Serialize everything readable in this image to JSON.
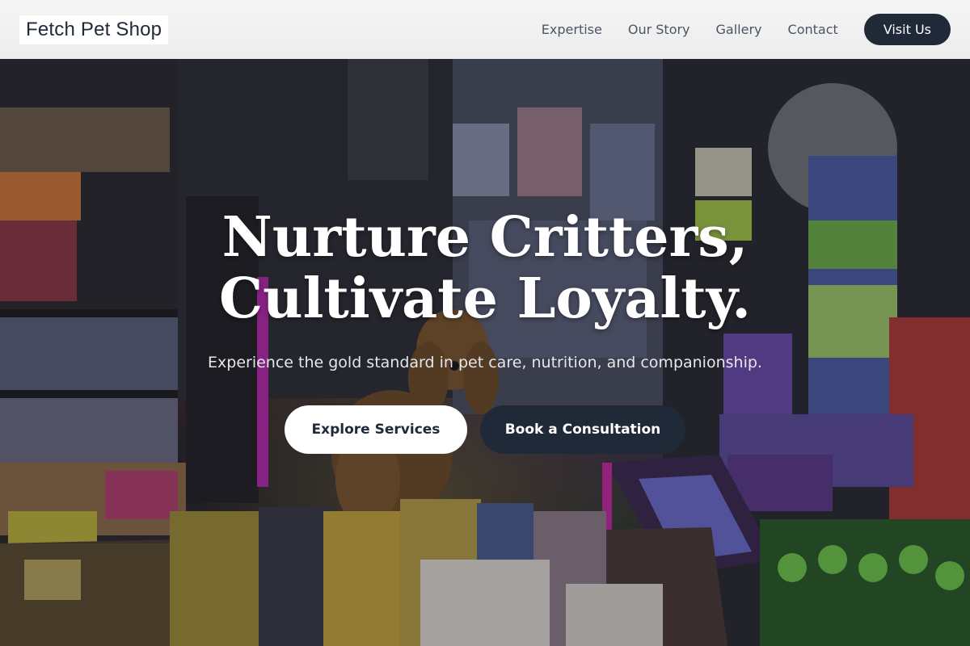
{
  "header": {
    "logo": "Fetch Pet Shop",
    "nav": [
      "Expertise",
      "Our Story",
      "Gallery",
      "Contact"
    ],
    "visit_label": "Visit Us"
  },
  "hero": {
    "headline_line1": "Nurture Critters,",
    "headline_line2": "Cultivate Loyalty.",
    "subtitle": "Experience the gold standard in pet care, nutrition, and companionship.",
    "explore_label": "Explore Services",
    "book_label": "Book a Consultation"
  },
  "colors": {
    "brand_dark": "#1f2937",
    "header_bg": "#f0f0f0",
    "white": "#ffffff"
  }
}
